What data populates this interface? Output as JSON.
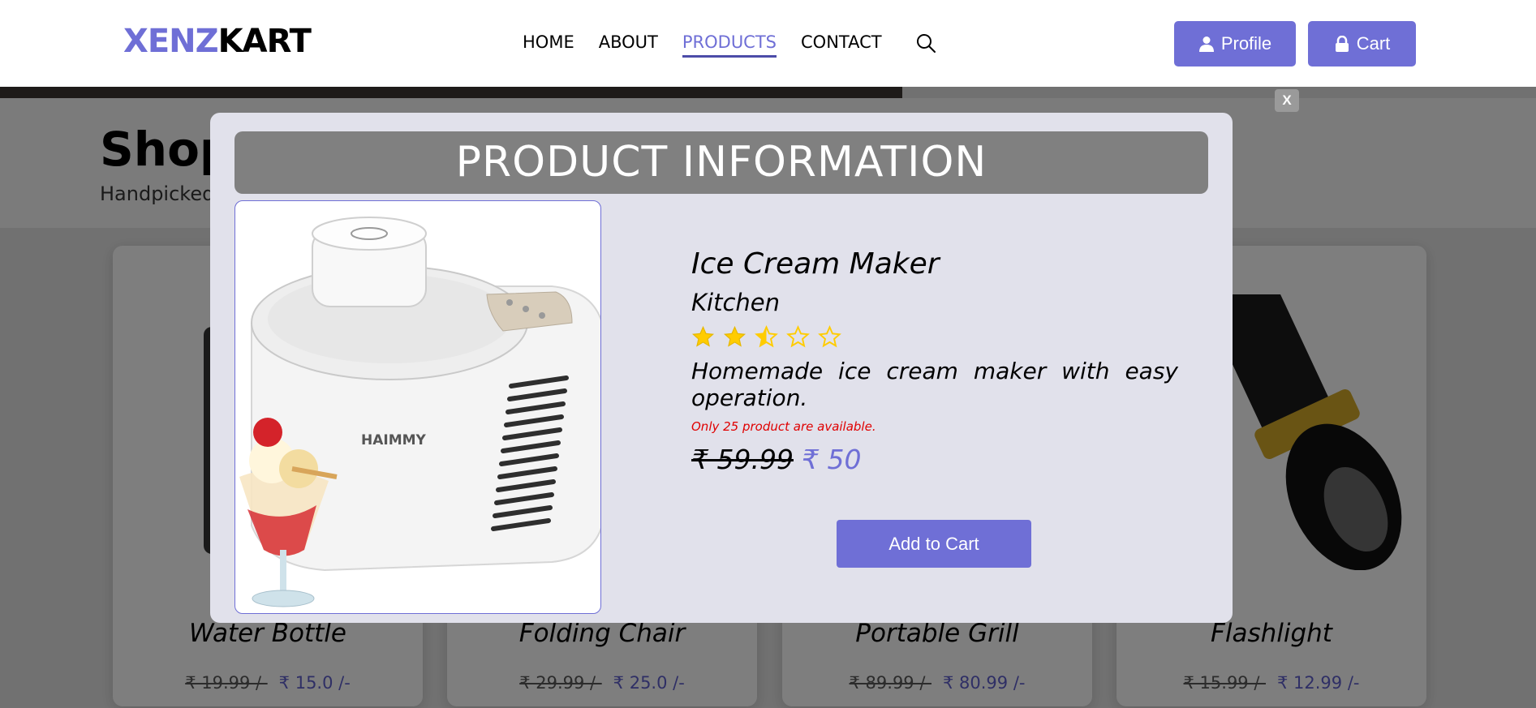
{
  "header": {
    "logo_accent": "XENZ",
    "logo_rest": "KART",
    "nav": [
      {
        "label": "HOME",
        "active": false
      },
      {
        "label": "ABOUT",
        "active": false
      },
      {
        "label": "PRODUCTS",
        "active": true
      },
      {
        "label": "CONTACT",
        "active": false
      }
    ],
    "search_icon": "search-icon",
    "profile_label": "Profile",
    "cart_label": "Cart"
  },
  "page": {
    "section_title": "Shop",
    "section_subtitle": "Handpicked"
  },
  "products": [
    {
      "name": "Water Bottle",
      "old_price": "₹ 19.99 /-",
      "new_price": "₹ 15.0 /-"
    },
    {
      "name": "Folding Chair",
      "old_price": "₹ 29.99 /-",
      "new_price": "₹ 25.0 /-"
    },
    {
      "name": "Portable Grill",
      "old_price": "₹ 89.99 /-",
      "new_price": "₹ 80.99 /-"
    },
    {
      "name": "Flashlight",
      "old_price": "₹ 15.99 /-",
      "new_price": "₹ 12.99 /-"
    }
  ],
  "modal": {
    "heading": "PRODUCT INFORMATION",
    "close_label": "X",
    "image_brand": "HAIMMY",
    "title": "Ice Cream Maker",
    "category": "Kitchen",
    "rating": 2.5,
    "rating_max": 5,
    "description": "Homemade ice cream maker with easy operation.",
    "stock_note": "Only 25 product are available.",
    "old_price": "₹ 59.99",
    "new_price": "₹ 50",
    "add_to_cart_label": "Add to Cart"
  },
  "colors": {
    "accent": "#6f6fd6",
    "star": "#ffcc00",
    "stock_warning": "#e00000",
    "modal_bg": "#e1e1eb",
    "modal_heading_bg": "#808080"
  }
}
